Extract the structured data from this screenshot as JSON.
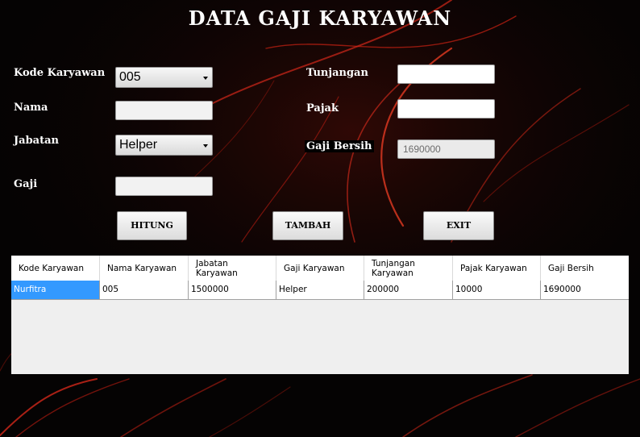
{
  "title": "DATA GAJI KARYAWAN",
  "form": {
    "kode_label": "Kode Karyawan",
    "kode_value": "005",
    "nama_label": "Nama",
    "nama_value": "",
    "jabatan_label": "Jabatan",
    "jabatan_value": "Helper",
    "gaji_label": "Gaji",
    "gaji_value": "",
    "tunjangan_label": "Tunjangan",
    "tunjangan_value": "",
    "pajak_label": "Pajak",
    "pajak_value": "",
    "gaji_bersih_label": "Gaji Bersih",
    "gaji_bersih_value": "1690000"
  },
  "buttons": {
    "hitung": "HITUNG",
    "tambah": "TAMBAH",
    "exit": "EXIT"
  },
  "table": {
    "headers": [
      "Kode Karyawan",
      "Nama Karyawan",
      "Jabatan Karyawan",
      "Gaji Karyawan",
      "Tunjangan Karyawan",
      "Pajak Karyawan",
      "Gaji Bersih"
    ],
    "rows": [
      [
        "Nurfitra",
        "005",
        "1500000",
        "Helper",
        "200000",
        "10000",
        "1690000"
      ]
    ]
  },
  "colors": {
    "background": "#050303",
    "streak": "#d2281a",
    "selection": "#3399ff"
  }
}
